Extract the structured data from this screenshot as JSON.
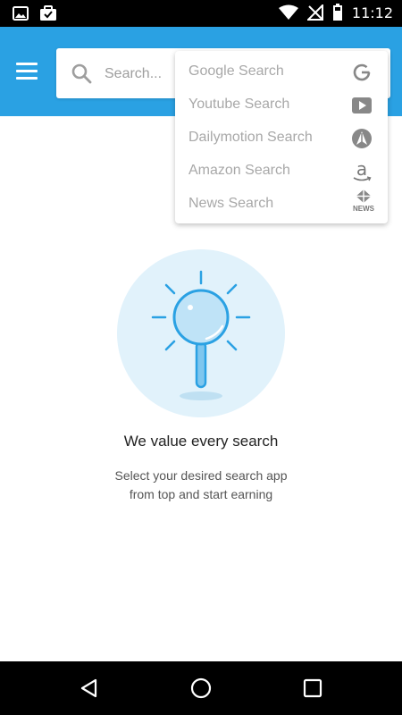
{
  "status_bar": {
    "time": "11:12",
    "icons": [
      "image-icon",
      "briefcase-check-icon",
      "wifi-icon",
      "no-signal-icon",
      "battery-icon"
    ]
  },
  "app_bar": {
    "color": "#2aa1e3",
    "menu_icon": "hamburger-menu-icon",
    "search": {
      "placeholder": "Search..."
    }
  },
  "dropdown": {
    "items": [
      {
        "label": "Google Search",
        "icon": "google-icon"
      },
      {
        "label": "Youtube Search",
        "icon": "youtube-icon"
      },
      {
        "label": "Dailymotion Search",
        "icon": "dailymotion-icon"
      },
      {
        "label": "Amazon Search",
        "icon": "amazon-icon"
      },
      {
        "label": "News Search",
        "icon": "news-icon",
        "icon_caption": "NEWS"
      }
    ]
  },
  "empty_state": {
    "illustration_icon": "magnifier-idea-icon",
    "headline": "We value every search",
    "subtext_line1": "Select your desired search app",
    "subtext_line2": "from top and start earning"
  },
  "nav_bar": {
    "buttons": [
      "back-icon",
      "home-icon",
      "recents-icon"
    ]
  }
}
